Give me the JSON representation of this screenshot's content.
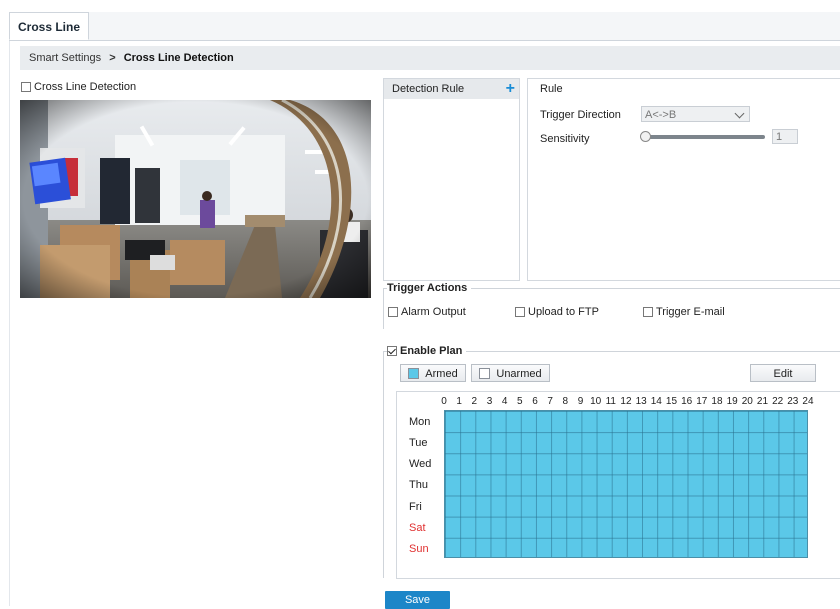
{
  "tab": {
    "title": "Cross Line"
  },
  "breadcrumb": {
    "parent": "Smart Settings",
    "separator": ">",
    "current": "Cross Line Detection"
  },
  "cross_line_toggle": {
    "label": "Cross Line Detection",
    "checked": false
  },
  "rule_list": {
    "header": "Detection Rule",
    "add_icon": "+"
  },
  "rule": {
    "title": "Rule",
    "trigger_direction_label": "Trigger Direction",
    "trigger_direction_value": "A<->B",
    "sensitivity_label": "Sensitivity",
    "sensitivity_value": "1"
  },
  "trigger_actions": {
    "legend": "Trigger Actions",
    "items": [
      {
        "label": "Alarm Output",
        "checked": false
      },
      {
        "label": "Upload to FTP",
        "checked": false
      },
      {
        "label": "Trigger E-mail",
        "checked": false
      }
    ]
  },
  "plan": {
    "legend": "Enable Plan",
    "enabled": true,
    "armed_label": "Armed",
    "unarmed_label": "Unarmed",
    "edit_label": "Edit",
    "armed_color": "#5bc8e8",
    "hours": [
      "0",
      "1",
      "2",
      "3",
      "4",
      "5",
      "6",
      "7",
      "8",
      "9",
      "10",
      "11",
      "12",
      "13",
      "14",
      "15",
      "16",
      "17",
      "18",
      "19",
      "20",
      "21",
      "22",
      "23",
      "24"
    ],
    "days": [
      "Mon",
      "Tue",
      "Wed",
      "Thu",
      "Fri",
      "Sat",
      "Sun"
    ],
    "weekend_color": "#e03030"
  },
  "save_label": "Save"
}
